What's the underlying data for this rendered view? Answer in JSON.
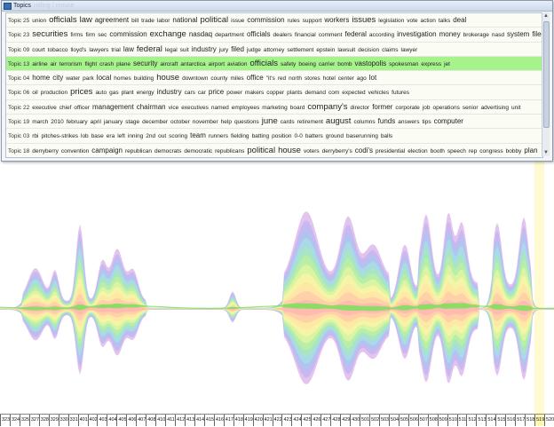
{
  "window": {
    "title": "Topics",
    "faded_title": "rolling / mouse"
  },
  "topics": [
    {
      "label": "Topic 25",
      "words": [
        [
          "union",
          1
        ],
        [
          "officials",
          3
        ],
        [
          "law",
          3
        ],
        [
          "agreement",
          2
        ],
        [
          "bill",
          1
        ],
        [
          "trade",
          1
        ],
        [
          "labor",
          1
        ],
        [
          "national",
          2
        ],
        [
          "political",
          3
        ],
        [
          "issue",
          1
        ],
        [
          "commission",
          2
        ],
        [
          "rules",
          1
        ],
        [
          "support",
          1
        ],
        [
          "workers",
          2
        ],
        [
          "issues",
          3
        ],
        [
          "legislation",
          1
        ],
        [
          "vote",
          1
        ],
        [
          "action",
          1
        ],
        [
          "talks",
          1
        ],
        [
          "deal",
          2
        ]
      ]
    },
    {
      "label": "Topic 23",
      "words": [
        [
          "securities",
          3
        ],
        [
          "firms",
          1
        ],
        [
          "firm",
          1
        ],
        [
          "sec",
          1
        ],
        [
          "commission",
          2
        ],
        [
          "exchange",
          3
        ],
        [
          "nasdaq",
          2
        ],
        [
          "department",
          1
        ],
        [
          "officials",
          2
        ],
        [
          "dealers",
          1
        ],
        [
          "financial",
          1
        ],
        [
          "comment",
          1
        ],
        [
          "federal",
          2
        ],
        [
          "according",
          1
        ],
        [
          "investigation",
          2
        ],
        [
          "money",
          2
        ],
        [
          "brokerage",
          1
        ],
        [
          "nasd",
          1
        ],
        [
          "system",
          2
        ],
        [
          "filed",
          2
        ]
      ]
    },
    {
      "label": "Topic 09",
      "words": [
        [
          "court",
          1
        ],
        [
          "tobacco",
          1
        ],
        [
          "lloyd's",
          1
        ],
        [
          "lawyers",
          1
        ],
        [
          "trial",
          1
        ],
        [
          "law",
          2
        ],
        [
          "federal",
          3
        ],
        [
          "legal",
          1
        ],
        [
          "suit",
          1
        ],
        [
          "industry",
          2
        ],
        [
          "jury",
          1
        ],
        [
          "filed",
          2
        ],
        [
          "judge",
          1
        ],
        [
          "attorney",
          1
        ],
        [
          "settlement",
          1
        ],
        [
          "epstein",
          1
        ],
        [
          "lawsuit",
          1
        ],
        [
          "decision",
          1
        ],
        [
          "claims",
          1
        ],
        [
          "lawyer",
          1
        ]
      ]
    },
    {
      "label": "Topic 13",
      "words": [
        [
          "airline",
          1
        ],
        [
          "air",
          1
        ],
        [
          "terrorism",
          1
        ],
        [
          "flight",
          1
        ],
        [
          "crash",
          1
        ],
        [
          "plane",
          1
        ],
        [
          "security",
          2
        ],
        [
          "aircraft",
          1
        ],
        [
          "antarctica",
          1
        ],
        [
          "airport",
          1
        ],
        [
          "aviation",
          1
        ],
        [
          "officials",
          3
        ],
        [
          "safety",
          1
        ],
        [
          "boeing",
          1
        ],
        [
          "carrier",
          1
        ],
        [
          "bomb",
          1
        ],
        [
          "vastopolis",
          2
        ],
        [
          "spokesman",
          1
        ],
        [
          "express",
          1
        ],
        [
          "jet",
          1
        ]
      ],
      "selected": true
    },
    {
      "label": "Topic 04",
      "words": [
        [
          "home",
          2
        ],
        [
          "city",
          2
        ],
        [
          "water",
          1
        ],
        [
          "park",
          1
        ],
        [
          "local",
          2
        ],
        [
          "homes",
          1
        ],
        [
          "building",
          1
        ],
        [
          "house",
          3
        ],
        [
          "downtown",
          1
        ],
        [
          "county",
          1
        ],
        [
          "miles",
          1
        ],
        [
          "office",
          2
        ],
        [
          "\"it's",
          1
        ],
        [
          "red",
          1
        ],
        [
          "north",
          1
        ],
        [
          "stores",
          1
        ],
        [
          "hotel",
          1
        ],
        [
          "center",
          1
        ],
        [
          "ago",
          1
        ],
        [
          "lot",
          2
        ]
      ]
    },
    {
      "label": "Topic 06",
      "words": [
        [
          "oil",
          1
        ],
        [
          "production",
          1
        ],
        [
          "prices",
          3
        ],
        [
          "auto",
          1
        ],
        [
          "gas",
          1
        ],
        [
          "plant",
          1
        ],
        [
          "energy",
          1
        ],
        [
          "industry",
          2
        ],
        [
          "cars",
          1
        ],
        [
          "car",
          1
        ],
        [
          "price",
          2
        ],
        [
          "power",
          1
        ],
        [
          "makers",
          1
        ],
        [
          "copper",
          1
        ],
        [
          "plants",
          1
        ],
        [
          "demand",
          1
        ],
        [
          "com",
          1
        ],
        [
          "expected",
          1
        ],
        [
          "vehicles",
          1
        ],
        [
          "futures",
          1
        ]
      ]
    },
    {
      "label": "Topic 22",
      "words": [
        [
          "executive",
          1
        ],
        [
          "chief",
          1
        ],
        [
          "officer",
          1
        ],
        [
          "management",
          2
        ],
        [
          "chairman",
          2
        ],
        [
          "vice",
          1
        ],
        [
          "executives",
          1
        ],
        [
          "named",
          1
        ],
        [
          "employees",
          1
        ],
        [
          "marketing",
          1
        ],
        [
          "board",
          1
        ],
        [
          "company's",
          3
        ],
        [
          "director",
          1
        ],
        [
          "former",
          2
        ],
        [
          "corporate",
          1
        ],
        [
          "job",
          1
        ],
        [
          "operations",
          1
        ],
        [
          "senior",
          1
        ],
        [
          "advertising",
          1
        ],
        [
          "unit",
          1
        ]
      ]
    },
    {
      "label": "Topic 19",
      "words": [
        [
          "march",
          1
        ],
        [
          "2010",
          1
        ],
        [
          "february",
          1
        ],
        [
          "april",
          1
        ],
        [
          "january",
          1
        ],
        [
          "stage",
          1
        ],
        [
          "december",
          1
        ],
        [
          "october",
          1
        ],
        [
          "november",
          1
        ],
        [
          "help",
          1
        ],
        [
          "questions",
          1
        ],
        [
          "june",
          3
        ],
        [
          "cards",
          1
        ],
        [
          "retirement",
          1
        ],
        [
          "august",
          3
        ],
        [
          "columns",
          1
        ],
        [
          "funds",
          2
        ],
        [
          "answers",
          1
        ],
        [
          "tips",
          1
        ],
        [
          "computer",
          2
        ]
      ]
    },
    {
      "label": "Topic 03",
      "words": [
        [
          "rbi",
          1
        ],
        [
          "pitches-strikes",
          1
        ],
        [
          "lob",
          1
        ],
        [
          "base",
          1
        ],
        [
          "era",
          1
        ],
        [
          "left",
          1
        ],
        [
          "inning",
          1
        ],
        [
          "2nd",
          1
        ],
        [
          "out",
          1
        ],
        [
          "scoring",
          1
        ],
        [
          "team",
          2
        ],
        [
          "runners",
          1
        ],
        [
          "fielding",
          1
        ],
        [
          "batting",
          1
        ],
        [
          "position",
          1
        ],
        [
          "0-0",
          1
        ],
        [
          "batters",
          1
        ],
        [
          "ground",
          1
        ],
        [
          "baserunning",
          1
        ],
        [
          "balls",
          1
        ]
      ]
    },
    {
      "label": "Topic 18",
      "words": [
        [
          "derryberry",
          1
        ],
        [
          "convention",
          1
        ],
        [
          "campaign",
          2
        ],
        [
          "republican",
          1
        ],
        [
          "democrats",
          1
        ],
        [
          "democratic",
          1
        ],
        [
          "republicans",
          1
        ],
        [
          "political",
          3
        ],
        [
          "house",
          3
        ],
        [
          "voters",
          1
        ],
        [
          "derryberry's",
          1
        ],
        [
          "codi's",
          2
        ],
        [
          "presidential",
          1
        ],
        [
          "election",
          1
        ],
        [
          "booth",
          1
        ],
        [
          "speech",
          1
        ],
        [
          "rep",
          1
        ],
        [
          "congress",
          1
        ],
        [
          "bobby",
          1
        ],
        [
          "plan",
          2
        ]
      ]
    }
  ],
  "timeline": {
    "ticks": [
      "323",
      "324",
      "325",
      "327",
      "328",
      "329",
      "330",
      "331",
      "401",
      "402",
      "403",
      "404",
      "405",
      "406",
      "407",
      "408",
      "410",
      "411",
      "412",
      "413",
      "414",
      "415",
      "416",
      "417",
      "418",
      "419",
      "420",
      "421",
      "422",
      "423",
      "424",
      "425",
      "426",
      "427",
      "428",
      "429",
      "430",
      "501",
      "502",
      "503",
      "504",
      "505",
      "506",
      "507",
      "508",
      "509",
      "510",
      "511",
      "512",
      "513",
      "514",
      "515",
      "516",
      "517",
      "518",
      "519",
      "520"
    ],
    "highlighted_tick": "519"
  },
  "stream_colors": [
    "#ffb3b3",
    "#ffc9a8",
    "#ffe3a6",
    "#fff4a8",
    "#e4f7a3",
    "#bff0a0",
    "#a8e8b8",
    "#a8e0e4",
    "#a8c8f0",
    "#c0b4f0",
    "#d8b0e8"
  ],
  "selected_color": "#7fe05f"
}
